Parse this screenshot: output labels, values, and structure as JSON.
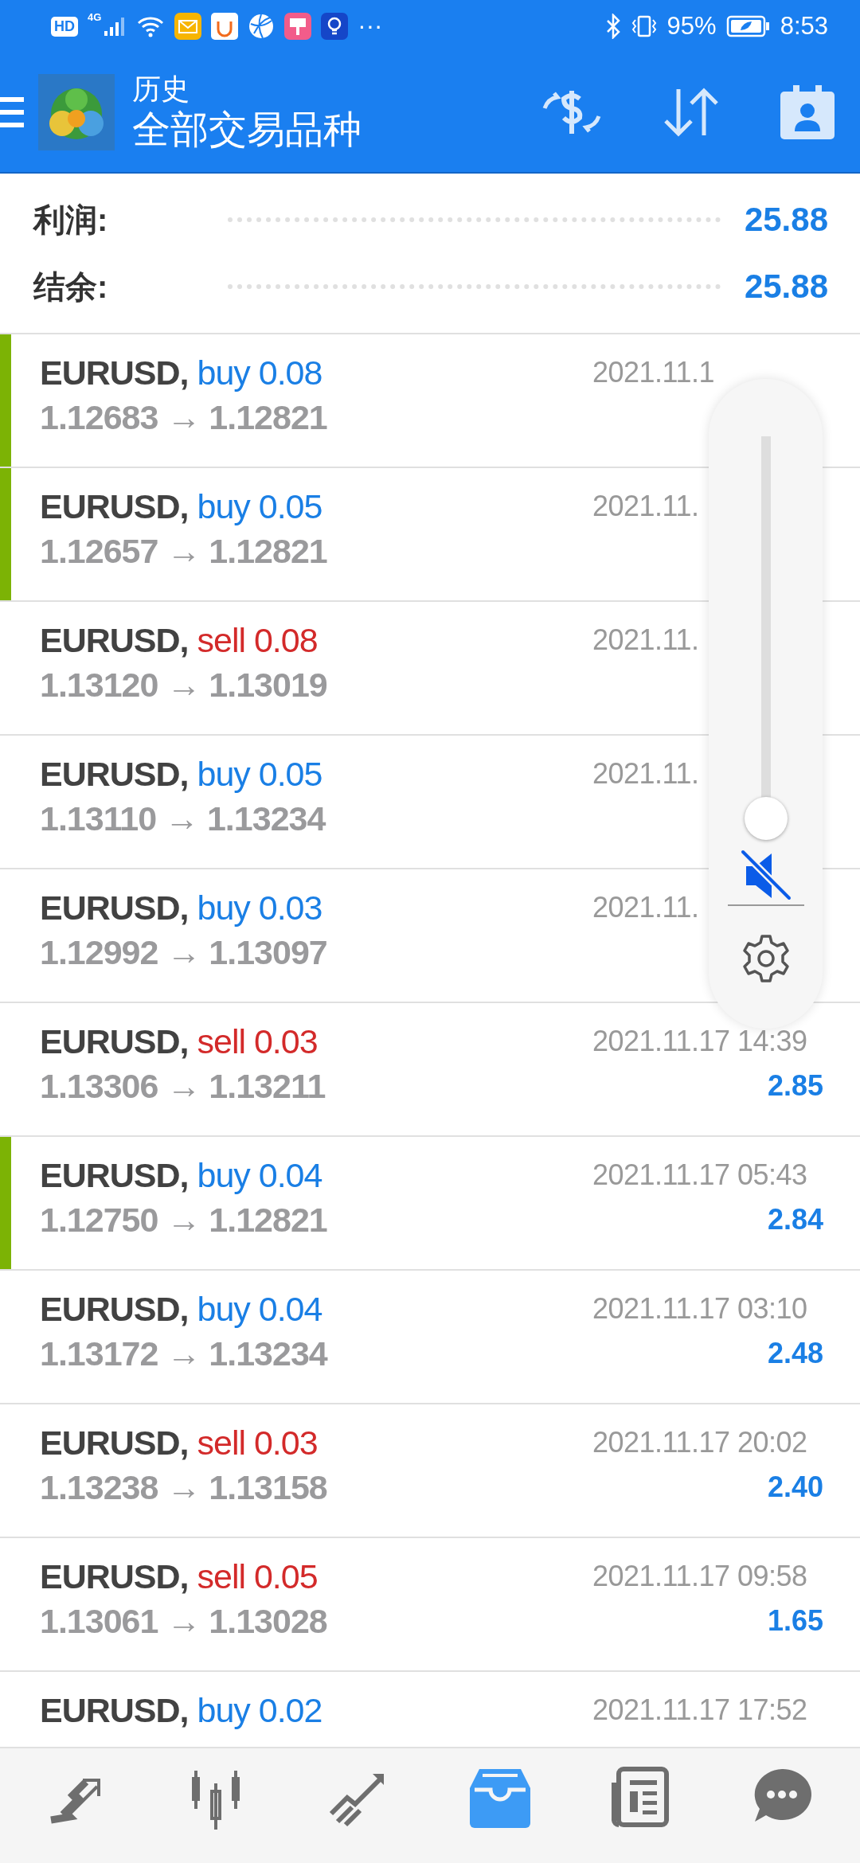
{
  "status_bar": {
    "hd": "HD",
    "network": "4G",
    "more": "···",
    "battery": "95%",
    "time": "8:53"
  },
  "header": {
    "title": "历史",
    "subtitle": "全部交易品种"
  },
  "summary": [
    {
      "label": "利润:",
      "value": "25.88"
    },
    {
      "label": "结余:",
      "value": "25.88"
    }
  ],
  "trades": [
    {
      "symbol": "EURUSD,",
      "kind": "buy",
      "order": "buy 0.08",
      "prices": "1.12683 → 1.12821",
      "time": "2021.11.1",
      "highlighted": true
    },
    {
      "symbol": "EURUSD,",
      "kind": "buy",
      "order": "buy 0.05",
      "prices": "1.12657 → 1.12821",
      "time": "2021.11.",
      "highlighted": true
    },
    {
      "symbol": "EURUSD,",
      "kind": "sell",
      "order": "sell 0.08",
      "prices": "1.13120 → 1.13019",
      "time": "2021.11.",
      "highlighted": false
    },
    {
      "symbol": "EURUSD,",
      "kind": "buy",
      "order": "buy 0.05",
      "prices": "1.13110 → 1.13234",
      "time": "2021.11.",
      "highlighted": false
    },
    {
      "symbol": "EURUSD,",
      "kind": "buy",
      "order": "buy 0.03",
      "prices": "1.12992 → 1.13097",
      "time": "2021.11.",
      "highlighted": false
    },
    {
      "symbol": "EURUSD,",
      "kind": "sell",
      "order": "sell 0.03",
      "prices": "1.13306 → 1.13211",
      "time": "2021.11.17 14:39",
      "profit": "2.85",
      "highlighted": false
    },
    {
      "symbol": "EURUSD,",
      "kind": "buy",
      "order": "buy 0.04",
      "prices": "1.12750 → 1.12821",
      "time": "2021.11.17 05:43",
      "profit": "2.84",
      "highlighted": true
    },
    {
      "symbol": "EURUSD,",
      "kind": "buy",
      "order": "buy 0.04",
      "prices": "1.13172 → 1.13234",
      "time": "2021.11.17 03:10",
      "profit": "2.48",
      "highlighted": false
    },
    {
      "symbol": "EURUSD,",
      "kind": "sell",
      "order": "sell 0.03",
      "prices": "1.13238 → 1.13158",
      "time": "2021.11.17 20:02",
      "profit": "2.40",
      "highlighted": false
    },
    {
      "symbol": "EURUSD,",
      "kind": "sell",
      "order": "sell 0.05",
      "prices": "1.13061 → 1.13028",
      "time": "2021.11.17 09:58",
      "profit": "1.65",
      "highlighted": false
    },
    {
      "symbol": "EURUSD,",
      "kind": "buy",
      "order": "buy 0.02",
      "time": "2021.11.17 17:52",
      "highlighted": false
    }
  ],
  "volume_panel": {
    "level": 0,
    "muted": true
  },
  "bottom_nav": [
    {
      "kind": "trade",
      "selected": false
    },
    {
      "kind": "quotes",
      "selected": false
    },
    {
      "kind": "chart",
      "selected": false
    },
    {
      "kind": "history",
      "selected": true
    },
    {
      "kind": "news",
      "selected": false
    },
    {
      "kind": "chat",
      "selected": false
    }
  ]
}
